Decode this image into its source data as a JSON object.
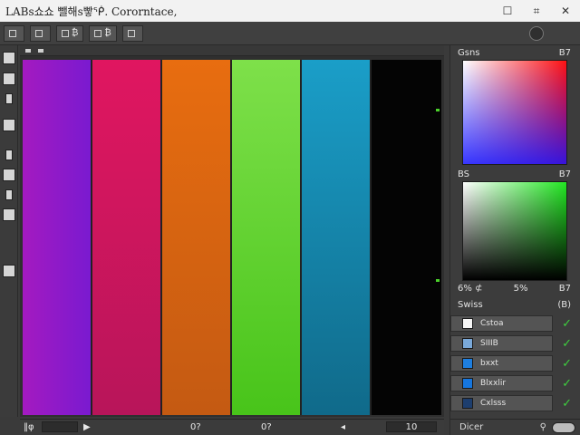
{
  "window": {
    "title": "LABs쇼쇼 뺄해ѕ빻ᖀ. Cororntace,",
    "minimize": "☐",
    "restore": "⌗",
    "close": "✕"
  },
  "toolbar": {
    "buttons": [
      "",
      "",
      "₿",
      "₿",
      ""
    ]
  },
  "canvas": {
    "swatches": [
      "purple",
      "red",
      "orange",
      "green",
      "blue",
      "black"
    ],
    "colors": {
      "purple": "#9b1ac4",
      "red": "#d3155d",
      "orange": "#df6a10",
      "green": "#62d22e",
      "blue": "#1688b0",
      "black": "#050505",
      "guide": "#4bd12a"
    }
  },
  "status": {
    "left_label": "‖φ",
    "arrow": "▶",
    "v1": "0?",
    "v2": "0?",
    "v3": "◂",
    "v4": "10"
  },
  "panel": {
    "picker1_label": "Gsns",
    "picker1_value": "B7",
    "picker2_label": "BS",
    "picker2_value": "B7",
    "picker2_footer_a": "6% ⊄",
    "picker2_footer_b": "5%",
    "picker2_footer_value": "B7",
    "layers_label": "Swiss",
    "layers_value": "(B)",
    "layers": [
      {
        "name": "Cstoa",
        "color": "#f5f5f5"
      },
      {
        "name": "SIIIB",
        "color": "#7aa9d9"
      },
      {
        "name": "bxxt",
        "color": "#1e7fe0"
      },
      {
        "name": "Blxxlir",
        "color": "#1676de"
      },
      {
        "name": "Cxlsss",
        "color": "#1d3e6e"
      }
    ],
    "footer_label": "Dicer",
    "footer_value": "⚲"
  }
}
